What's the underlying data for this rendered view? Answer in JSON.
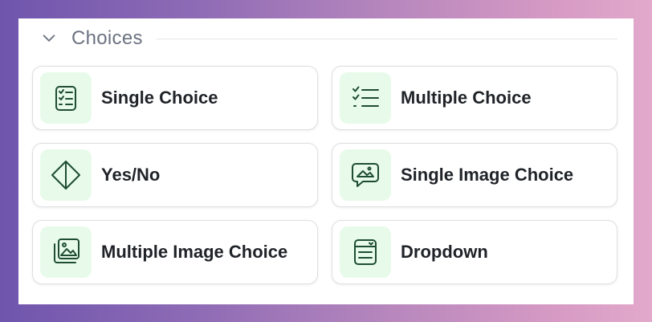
{
  "section": {
    "title": "Choices",
    "collapse_icon": "chevron-down-icon"
  },
  "colors": {
    "icon_bg": "#e8fbea",
    "icon_stroke": "#1f4d34",
    "label": "#1f2328",
    "section_title": "#6b7280"
  },
  "items": [
    {
      "label": "Single Choice",
      "icon": "checklist-icon"
    },
    {
      "label": "Multiple Choice",
      "icon": "multi-check-list-icon"
    },
    {
      "label": "Yes/No",
      "icon": "diamond-split-icon"
    },
    {
      "label": "Single Image Choice",
      "icon": "image-message-icon"
    },
    {
      "label": "Multiple Image Choice",
      "icon": "image-stack-icon"
    },
    {
      "label": "Dropdown",
      "icon": "dropdown-box-icon"
    }
  ]
}
